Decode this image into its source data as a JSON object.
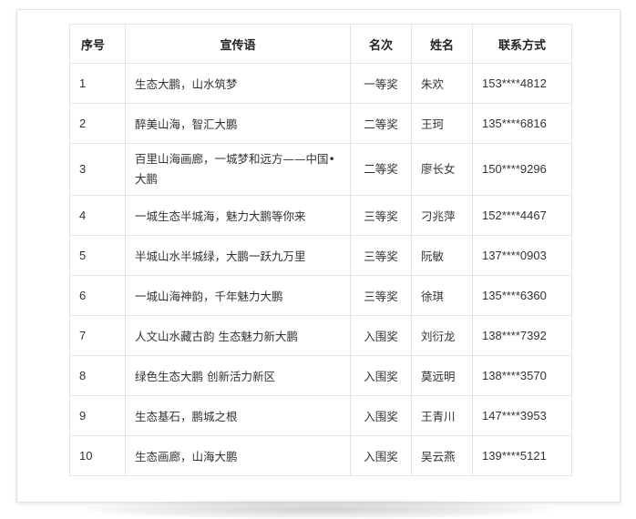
{
  "table": {
    "headers": {
      "no": "序号",
      "slogan": "宣传语",
      "rank": "名次",
      "name": "姓名",
      "contact": "联系方式"
    },
    "rows": [
      {
        "no": "1",
        "slogan": "生态大鹏，山水筑梦",
        "rank": "一等奖",
        "name": "朱欢",
        "contact": "153****4812"
      },
      {
        "no": "2",
        "slogan": "醉美山海，智汇大鹏",
        "rank": "二等奖",
        "name": "王珂",
        "contact": "135****6816"
      },
      {
        "no": "3",
        "slogan": "百里山海画廊，一城梦和远方——中国•大鹏",
        "rank": "二等奖",
        "name": "廖长女",
        "contact": "150****9296"
      },
      {
        "no": "4",
        "slogan": "一城生态半城海，魅力大鹏等你来",
        "rank": "三等奖",
        "name": "刁兆萍",
        "contact": "152****4467"
      },
      {
        "no": "5",
        "slogan": "半城山水半城绿，大鹏一跃九万里",
        "rank": "三等奖",
        "name": "阮敏",
        "contact": "137****0903"
      },
      {
        "no": "6",
        "slogan": "一城山海神韵，千年魅力大鹏",
        "rank": "三等奖",
        "name": "徐琪",
        "contact": "135****6360"
      },
      {
        "no": "7",
        "slogan": "人文山水藏古韵 生态魅力新大鹏",
        "rank": "入围奖",
        "name": "刘衍龙",
        "contact": "138****7392"
      },
      {
        "no": "8",
        "slogan": "绿色生态大鹏 创新活力新区",
        "rank": "入围奖",
        "name": "莫远明",
        "contact": "138****3570"
      },
      {
        "no": "9",
        "slogan": "生态基石，鹏城之根",
        "rank": "入围奖",
        "name": "王青川",
        "contact": "147****3953"
      },
      {
        "no": "10",
        "slogan": "生态画廊，山海大鹏",
        "rank": "入围奖",
        "name": "吴云燕",
        "contact": "139****5121"
      }
    ]
  }
}
